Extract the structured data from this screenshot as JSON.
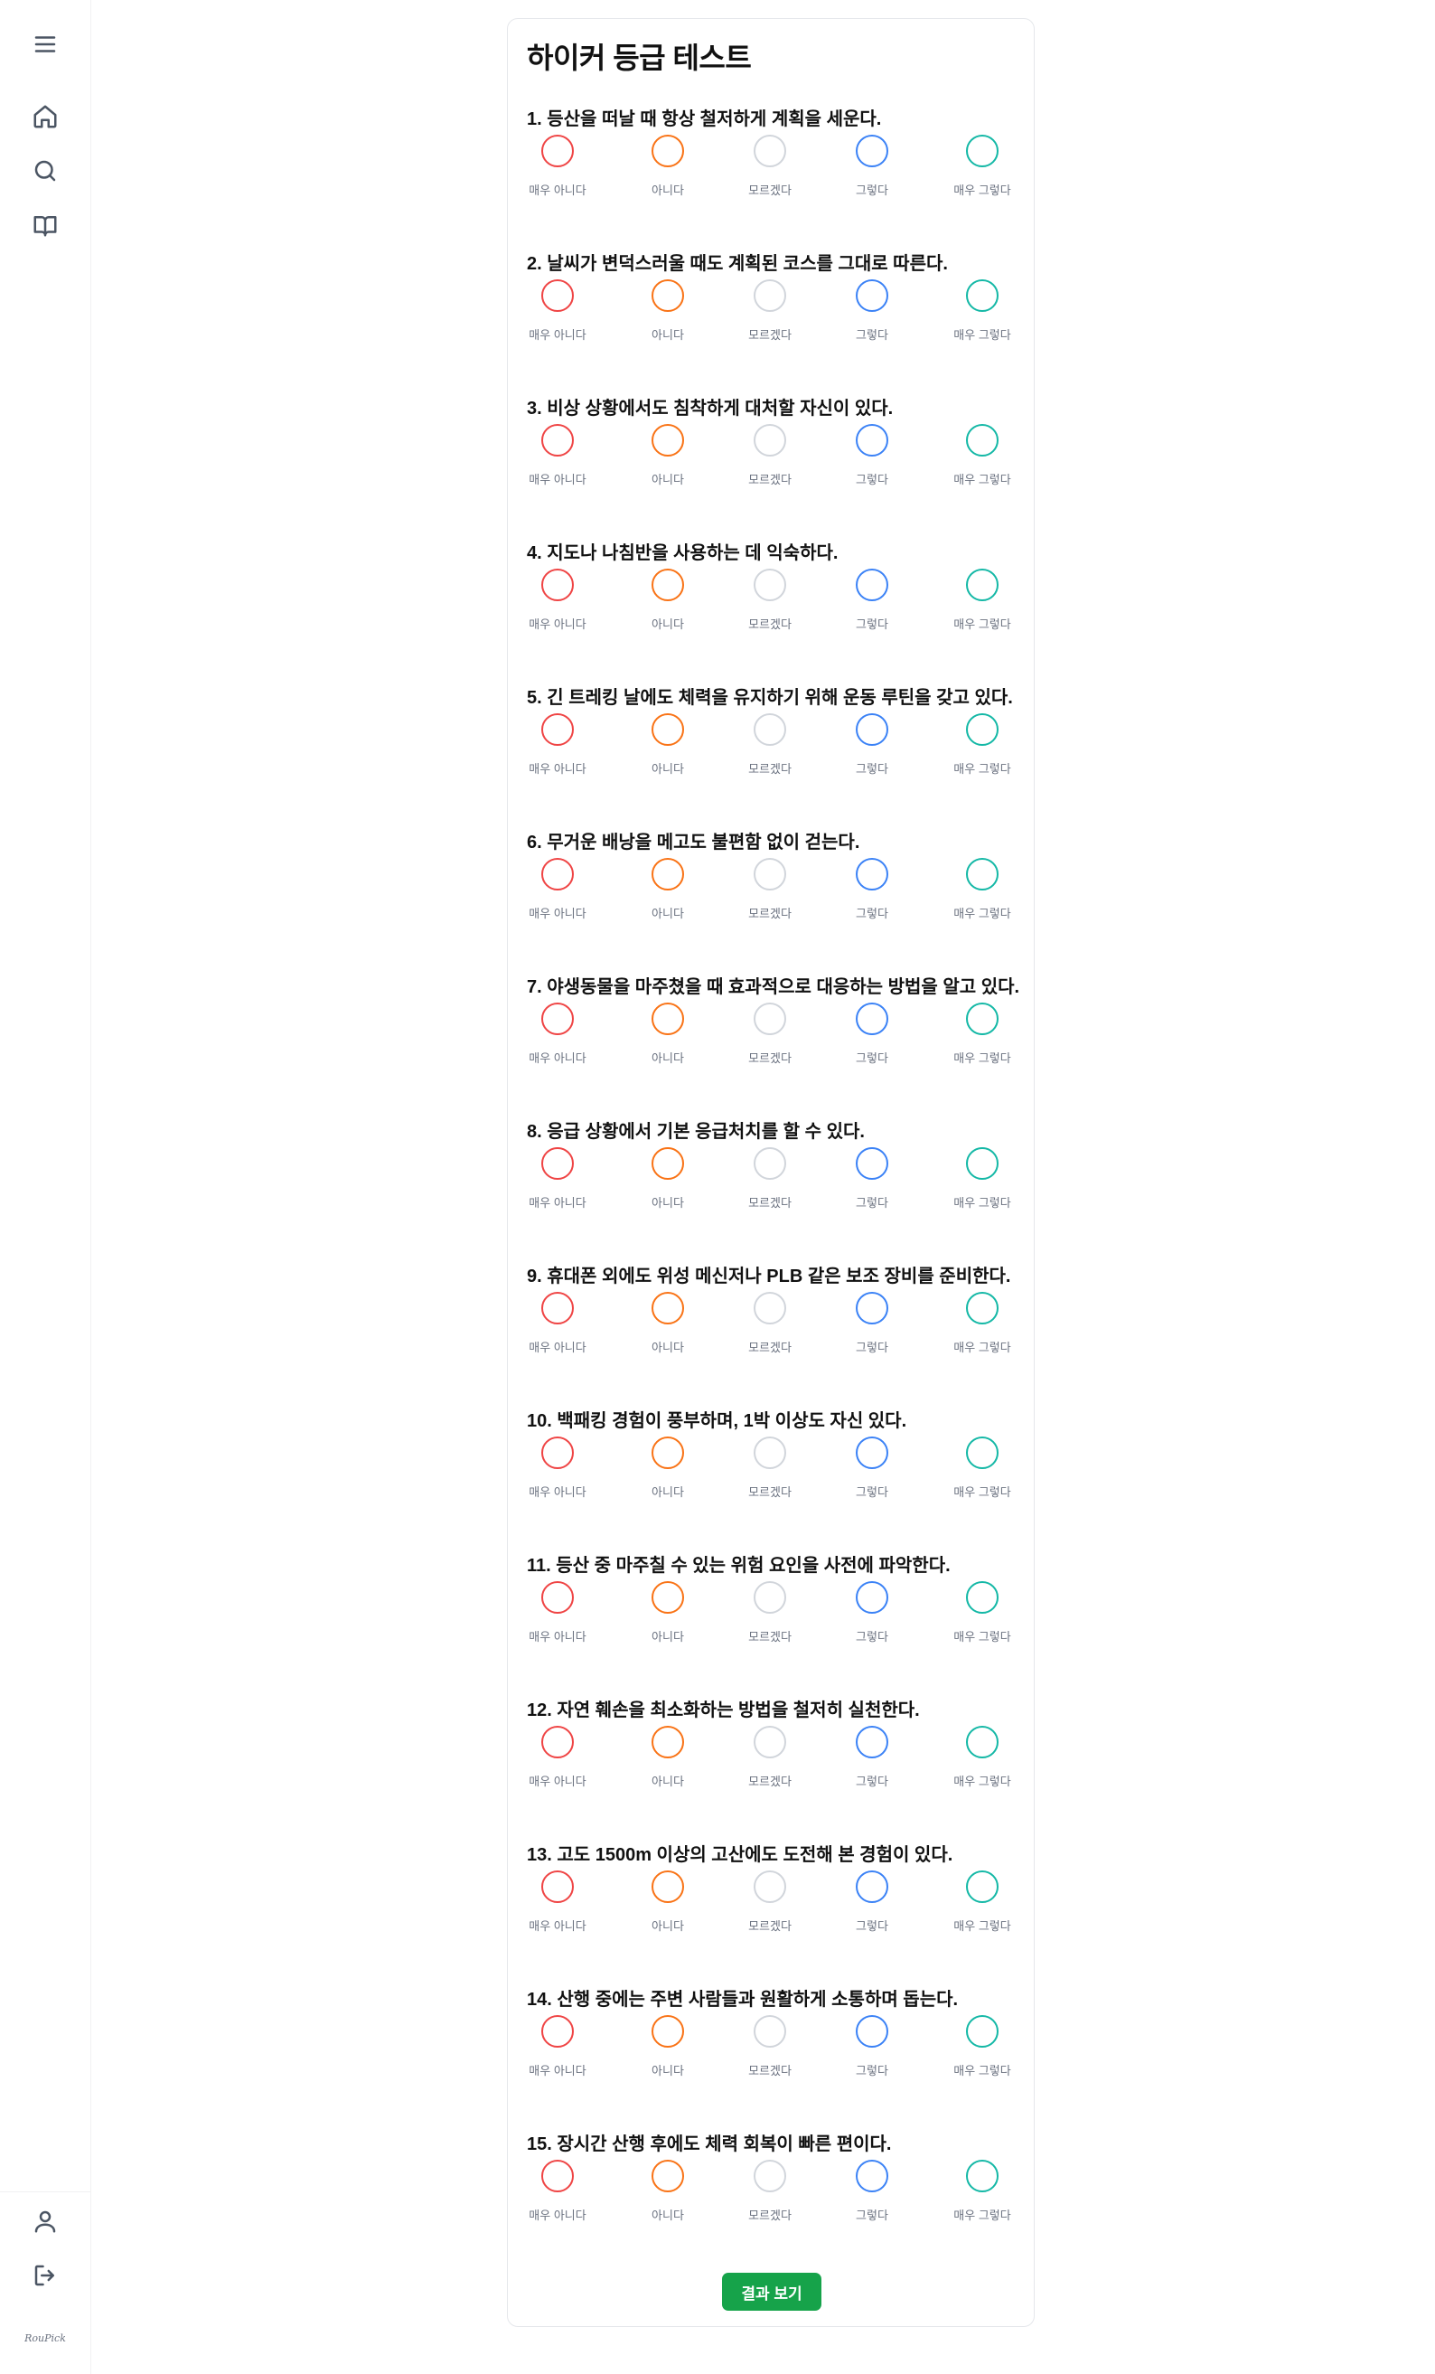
{
  "app": {
    "brand": "RouPick"
  },
  "sidebar": {
    "top_icons": [
      {
        "icon": "menu-icon"
      },
      {
        "icon": "home-icon"
      },
      {
        "icon": "search-icon"
      },
      {
        "icon": "book-icon"
      }
    ],
    "bottom_icons": [
      {
        "icon": "user-icon"
      },
      {
        "icon": "logout-icon"
      }
    ]
  },
  "survey": {
    "title": "하이커 등급 테스트",
    "options": [
      {
        "label": "매우 아니다",
        "color": "#ef4444"
      },
      {
        "label": "아니다",
        "color": "#f97316"
      },
      {
        "label": "모르겠다",
        "color": "#d1d5db"
      },
      {
        "label": "그렇다",
        "color": "#3b82f6"
      },
      {
        "label": "매우 그렇다",
        "color": "#14b8a6"
      }
    ],
    "questions": [
      "1. 등산을 떠날 때 항상 철저하게 계획을 세운다.",
      "2. 날씨가 변덕스러울 때도 계획된 코스를 그대로 따른다.",
      "3. 비상 상황에서도 침착하게 대처할 자신이 있다.",
      "4. 지도나 나침반을 사용하는 데 익숙하다.",
      "5. 긴 트레킹 날에도 체력을 유지하기 위해 운동 루틴을 갖고 있다.",
      "6. 무거운 배낭을 메고도 불편함 없이 걷는다.",
      "7. 야생동물을 마주쳤을 때 효과적으로 대응하는 방법을 알고 있다.",
      "8. 응급 상황에서 기본 응급처치를 할 수 있다.",
      "9. 휴대폰 외에도 위성 메신저나 PLB 같은 보조 장비를 준비한다.",
      "10. 백패킹 경험이 풍부하며, 1박 이상도 자신 있다.",
      "11. 등산 중 마주칠 수 있는 위험 요인을 사전에 파악한다.",
      "12. 자연 훼손을 최소화하는 방법을 철저히 실천한다.",
      "13. 고도 1500m 이상의 고산에도 도전해 본 경험이 있다.",
      "14. 산행 중에는 주변 사람들과 원활하게 소통하며 돕는다.",
      "15. 장시간 산행 후에도 체력 회복이 빠른 편이다."
    ],
    "submit_label": "결과 보기"
  }
}
